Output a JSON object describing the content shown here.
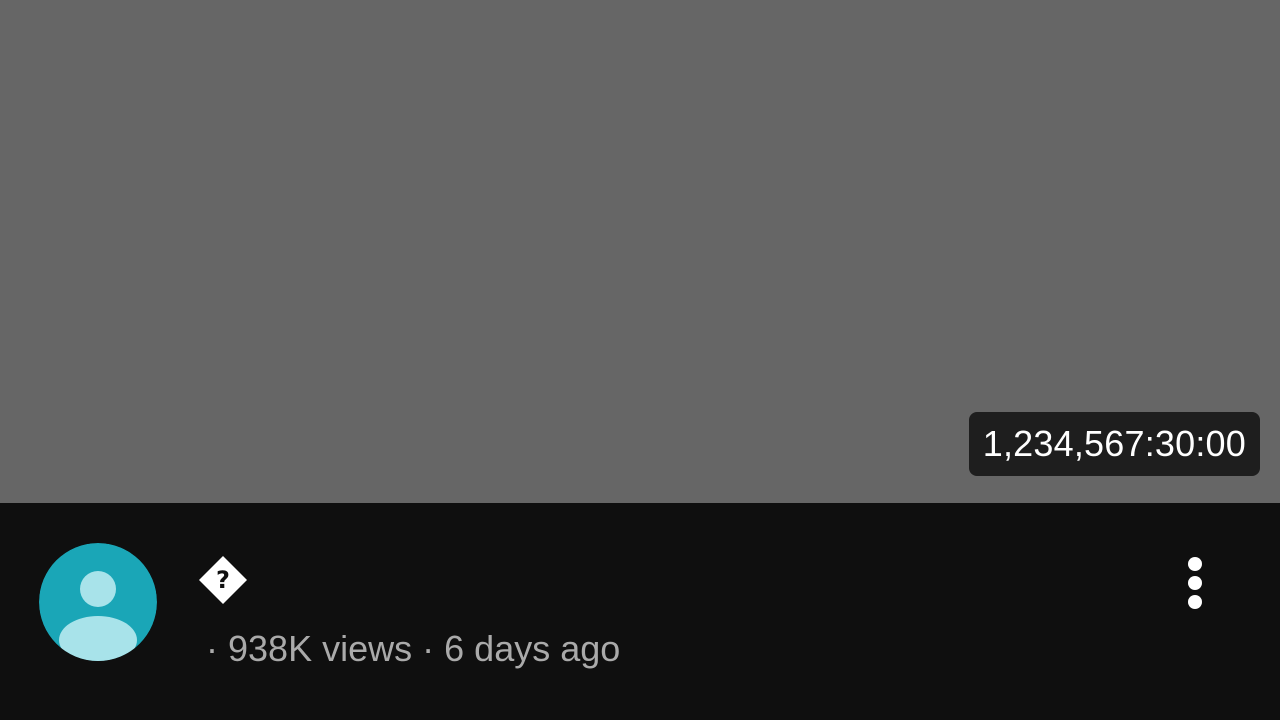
{
  "video": {
    "duration": "1,234,567:30:00",
    "title": "",
    "views": "938K views",
    "age": "6 days ago",
    "separator": "·"
  },
  "colors": {
    "thumbnail_bg": "#666666",
    "page_bg": "#0f0f0f",
    "avatar_bg": "#1aa6b7",
    "avatar_figure": "#a8e3ea",
    "meta_text": "#aaaaaa"
  },
  "icons": {
    "avatar": "default-user-avatar-icon",
    "title_glyph": "unknown-character-icon",
    "menu": "more-vertical-icon"
  }
}
